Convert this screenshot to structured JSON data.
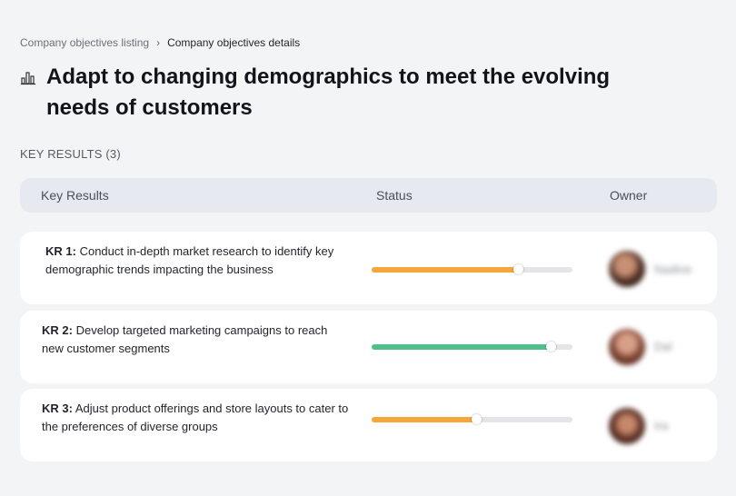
{
  "breadcrumb": {
    "parent": "Company objectives listing",
    "current": "Company objectives details"
  },
  "objective": {
    "title": "Adapt to changing demographics to meet the evolving needs of customers",
    "icon": "bar-chart-icon"
  },
  "key_results_section": {
    "label": "KEY RESULTS (3)"
  },
  "table": {
    "headers": {
      "key_results": "Key Results",
      "status": "Status",
      "owner": "Owner"
    }
  },
  "key_results": [
    {
      "id": "KR 1:",
      "text": "Conduct in-depth market research to identify key demographic trends impacting the business",
      "progress": 0.73,
      "color": "#f6a63a",
      "owner": "Nadine"
    },
    {
      "id": "KR 2:",
      "text": "Develop targeted marketing campaigns to reach new customer segments",
      "progress": 0.89,
      "color": "#4fc08a",
      "owner": "Dal"
    },
    {
      "id": "KR 3:",
      "text": "Adjust product offerings and store layouts to cater to the preferences of diverse groups",
      "progress": 0.52,
      "color": "#f6a63a",
      "owner": "Ira"
    }
  ]
}
